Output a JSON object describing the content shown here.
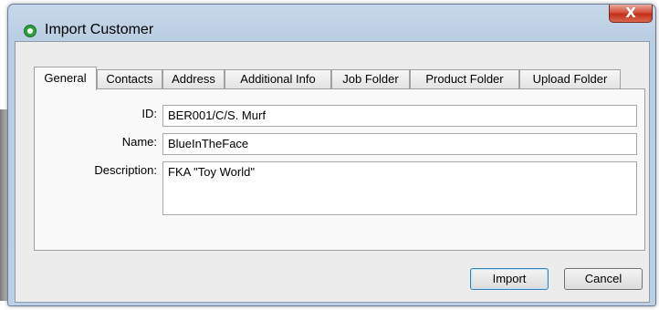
{
  "window": {
    "title": "Import Customer",
    "close_glyph": "X",
    "icon": "green-circle-app-icon"
  },
  "tabs": [
    {
      "label": "General",
      "active": true
    },
    {
      "label": "Contacts",
      "active": false
    },
    {
      "label": "Address",
      "active": false
    },
    {
      "label": "Additional Info",
      "active": false
    },
    {
      "label": "Job Folder",
      "active": false
    },
    {
      "label": "Product Folder",
      "active": false
    },
    {
      "label": "Upload Folder",
      "active": false
    }
  ],
  "form": {
    "id_label": "ID:",
    "id_value": "BER001/C/S. Murf",
    "name_label": "Name:",
    "name_value": "BlueInTheFace",
    "description_label": "Description:",
    "description_value": "FKA \"Toy World\""
  },
  "buttons": {
    "import_label": "Import",
    "cancel_label": "Cancel"
  }
}
